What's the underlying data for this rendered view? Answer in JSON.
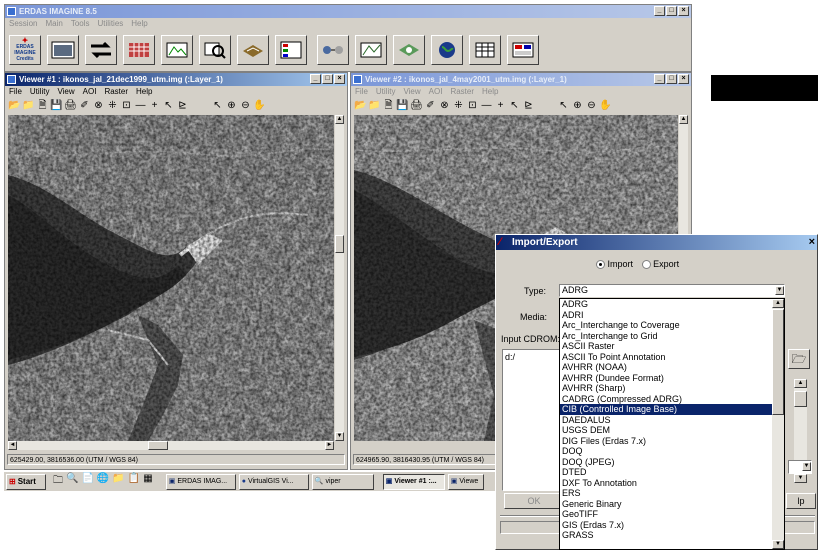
{
  "main_app": {
    "title": "ERDAS IMAGINE 8.5",
    "menu": [
      "Session",
      "Main",
      "Tools",
      "Utilities",
      "Help"
    ],
    "logo_lines": [
      "ERDAS",
      "IMAGINE",
      "Credits"
    ],
    "toolbar_icons": [
      "viewer-icon",
      "import-icon",
      "data-prep-icon",
      "composer-icon",
      "interpreter-icon",
      "catalog-icon",
      "classifier-icon",
      "modeler-icon",
      "vector-icon",
      "radar-icon",
      "virtualgis-icon",
      "ortho-icon",
      "subpixel-icon"
    ]
  },
  "viewer1": {
    "title": "Viewer #1 : ikonos_jal_21dec1999_utm.img (:Layer_1)",
    "menu": [
      "File",
      "Utility",
      "View",
      "AOI",
      "Raster",
      "Help"
    ],
    "status": "625429.00, 3816536.00  (UTM / WGS 84)"
  },
  "viewer2": {
    "title": "Viewer #2 : ikonos_jal_4may2001_utm.img (:Layer_1)",
    "menu": [
      "File",
      "Utility",
      "View",
      "AOI",
      "Raster",
      "Help"
    ],
    "status": "624965.90, 3816430.95  (UTM / WGS 84)"
  },
  "viewer_tools": [
    "📂",
    "📁",
    "🗎",
    "💾",
    "🖨",
    "✐",
    "⊗",
    "⁜",
    "⊡",
    "—",
    "+",
    "↖",
    "⊵"
  ],
  "viewer_tools_right": [
    "↖",
    "⊕",
    "⊖",
    "✋"
  ],
  "import_dialog": {
    "title": "Import/Export",
    "import_label": "Import",
    "export_label": "Export",
    "type_label": "Type:",
    "type_value": "ADRG",
    "media_label": "Media:",
    "input_cdrom_label": "Input CDROM:",
    "path_value": "d:/",
    "ok_label": "OK",
    "help_label": "lp",
    "type_options": [
      "ADRG",
      "ADRI",
      "Arc_Interchange to Coverage",
      "Arc_Interchange to Grid",
      "ASCII Raster",
      "ASCII To Point Annotation",
      "AVHRR (NOAA)",
      "AVHRR (Dundee Format)",
      "AVHRR (Sharp)",
      "CADRG (Compressed ADRG)",
      "CIB (Controlled Image Base)",
      "DAEDALUS",
      "USGS DEM",
      "DIG Files (Erdas 7.x)",
      "DOQ",
      "DOQ (JPEG)",
      "DTED",
      "DXF To Annotation",
      "ERS",
      "Generic Binary",
      "GeoTIFF",
      "GIS (Erdas 7.x)",
      "GRASS"
    ],
    "selected_option": "CIB (Controlled Image Base)"
  },
  "taskbar": {
    "start_label": "Start",
    "items": [
      "ERDAS IMAG...",
      "VirtualGIS Vi...",
      "viper",
      "Viewer #1 :...",
      "Viewe"
    ]
  },
  "colors": {
    "title_active": "#0a246a",
    "title_inactive": "#7a96d8",
    "face": "#d4d0c8"
  }
}
